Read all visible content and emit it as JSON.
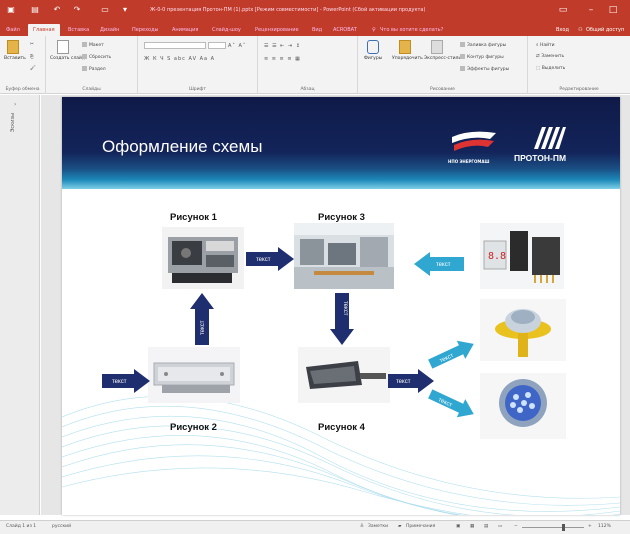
{
  "app": {
    "title": "Ж-0-0 презентация Протон-ПМ (1).pptx [Режим совместимости] - PowerPoint (Сбой активации продукта)"
  },
  "tabs": {
    "items": [
      "Файл",
      "Главная",
      "Вставка",
      "Дизайн",
      "Переходы",
      "Анимация",
      "Слайд-шоу",
      "Рецензирование",
      "Вид",
      "ACROBAT"
    ],
    "tell_me": "Что вы хотите сделать?",
    "sign_in": "Вход",
    "share": "Общий доступ"
  },
  "ribbon": {
    "paste": "Вставить",
    "clipboard_label": "Буфер обмена",
    "new_slide": "Создать слайд",
    "layout": "Макет",
    "reset": "Сбросить",
    "section": "Раздел",
    "slides_label": "Слайды",
    "font_label": "Шрифт",
    "paragraph_label": "Абзац",
    "shapes": "Фигуры",
    "arrange": "Упорядочить",
    "quick_styles": "Экспресс-стили",
    "fill": "Заливка фигуры",
    "outline": "Контур фигуры",
    "effects": "Эффекты фигуры",
    "drawing_label": "Рисование",
    "find": "Найти",
    "replace": "Заменить",
    "select": "Выделить",
    "editing_label": "Редактирование"
  },
  "pane": {
    "label": "Эскизы"
  },
  "slide": {
    "title": "Оформление схемы",
    "logo1_text": "НПО ЭНЕРГОМАШ",
    "logo2_text": "ПРОТОН-ПМ",
    "labels": {
      "pic1": "Рисунок 1",
      "pic2": "Рисунок 2",
      "pic3": "Рисунок 3",
      "pic4": "Рисунок 4"
    },
    "arrow_text": "текст"
  },
  "status": {
    "slide_info": "Слайд 1 из 1",
    "language": "русский",
    "notes": "Заметки",
    "comments": "Примечания",
    "zoom": "112%"
  },
  "colors": {
    "office_red": "#c13b2a",
    "header_navy": "#13245a",
    "arrow_navy": "#1f2e6e",
    "arrow_cyan": "#2fa7d0"
  }
}
